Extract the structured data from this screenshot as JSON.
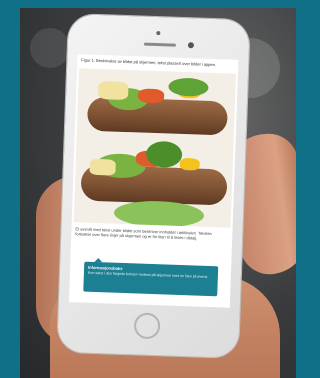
{
  "article": {
    "caption": "Figur 1: Beskrivelse av bildet på skjermen, tekst plassert over bildet i appen.",
    "body": "Et avsnitt med tekst under bildet som beskriver innholdet i artikkelen. Teksten fortsetter over flere linjer på skjermen og er for liten til å leses i detalj.",
    "notice_title": "Informasjonsboks",
    "notice_text": "Kort tekst i den fargede boksen nederst på skjermen med en liten pil øverst."
  },
  "colors": {
    "background": "#0f7088",
    "notice": "#1d7f92",
    "phone_body": "#ececec"
  }
}
